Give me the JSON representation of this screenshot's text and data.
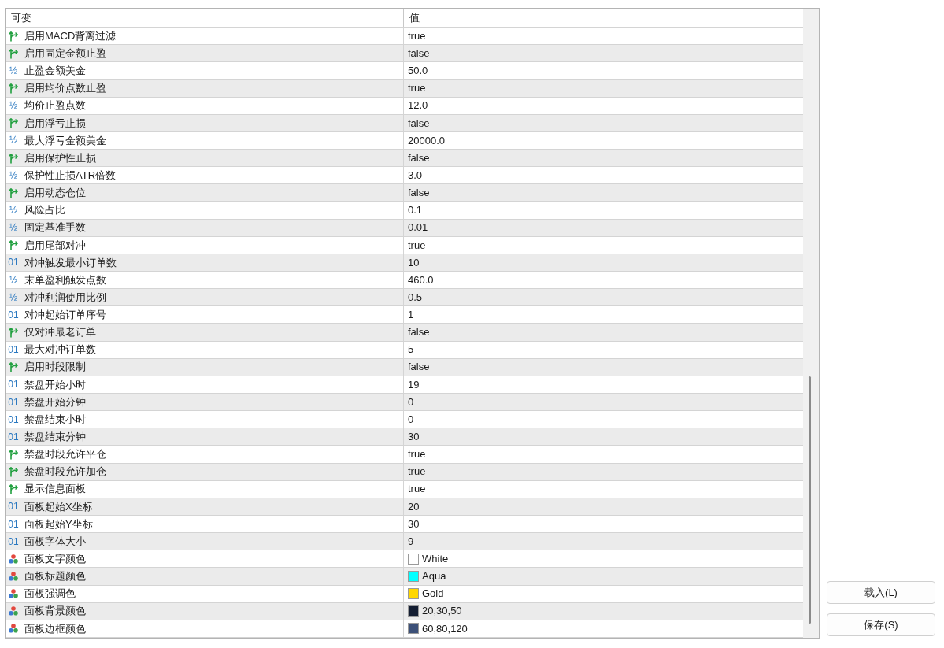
{
  "table": {
    "columns": [
      "可变",
      "值"
    ],
    "rows": [
      {
        "kind": "bool",
        "name": "启用MACD背离过滤",
        "value": "true"
      },
      {
        "kind": "bool",
        "name": "启用固定金额止盈",
        "value": "false"
      },
      {
        "kind": "double",
        "type_label": "½",
        "name": "止盈金额美金",
        "value": "50.0"
      },
      {
        "kind": "bool",
        "name": "启用均价点数止盈",
        "value": "true"
      },
      {
        "kind": "double",
        "type_label": "½",
        "name": "均价止盈点数",
        "value": "12.0"
      },
      {
        "kind": "bool",
        "name": "启用浮亏止损",
        "value": "false"
      },
      {
        "kind": "double",
        "type_label": "½",
        "name": "最大浮亏金额美金",
        "value": "20000.0"
      },
      {
        "kind": "bool",
        "name": "启用保护性止损",
        "value": "false"
      },
      {
        "kind": "double",
        "type_label": "½",
        "name": "保护性止损ATR倍数",
        "value": "3.0"
      },
      {
        "kind": "bool",
        "name": "启用动态仓位",
        "value": "false"
      },
      {
        "kind": "double",
        "type_label": "½",
        "name": "风险占比",
        "value": "0.1"
      },
      {
        "kind": "double",
        "type_label": "½",
        "name": "固定基准手数",
        "value": "0.01"
      },
      {
        "kind": "bool",
        "name": "启用尾部对冲",
        "value": "true"
      },
      {
        "kind": "int",
        "type_label": "01",
        "name": "对冲触发最小订单数",
        "value": "10"
      },
      {
        "kind": "double",
        "type_label": "½",
        "name": "末单盈利触发点数",
        "value": "460.0"
      },
      {
        "kind": "double",
        "type_label": "½",
        "name": "对冲利润使用比例",
        "value": "0.5"
      },
      {
        "kind": "int",
        "type_label": "01",
        "name": "对冲起始订单序号",
        "value": "1"
      },
      {
        "kind": "bool",
        "name": "仅对冲最老订单",
        "value": "false"
      },
      {
        "kind": "int",
        "type_label": "01",
        "name": "最大对冲订单数",
        "value": "5"
      },
      {
        "kind": "bool",
        "name": "启用时段限制",
        "value": "false"
      },
      {
        "kind": "int",
        "type_label": "01",
        "name": "禁盘开始小时",
        "value": "19"
      },
      {
        "kind": "int",
        "type_label": "01",
        "name": "禁盘开始分钟",
        "value": "0"
      },
      {
        "kind": "int",
        "type_label": "01",
        "name": "禁盘结束小时",
        "value": "0"
      },
      {
        "kind": "int",
        "type_label": "01",
        "name": "禁盘结束分钟",
        "value": "30"
      },
      {
        "kind": "bool",
        "name": "禁盘时段允许平仓",
        "value": "true"
      },
      {
        "kind": "bool",
        "name": "禁盘时段允许加仓",
        "value": "true"
      },
      {
        "kind": "bool",
        "name": "显示信息面板",
        "value": "true"
      },
      {
        "kind": "int",
        "type_label": "01",
        "name": "面板起始X坐标",
        "value": "20"
      },
      {
        "kind": "int",
        "type_label": "01",
        "name": "面板起始Y坐标",
        "value": "30"
      },
      {
        "kind": "int",
        "type_label": "01",
        "name": "面板字体大小",
        "value": "9"
      },
      {
        "kind": "color",
        "name": "面板文字颜色",
        "value": "White",
        "color": "#ffffff"
      },
      {
        "kind": "color",
        "name": "面板标题颜色",
        "value": "Aqua",
        "color": "#00ffff"
      },
      {
        "kind": "color",
        "name": "面板强调色",
        "value": "Gold",
        "color": "#ffd700"
      },
      {
        "kind": "color",
        "name": "面板背景颜色",
        "value": "20,30,50",
        "color": "#141e32"
      },
      {
        "kind": "color",
        "name": "面板边框颜色",
        "value": "60,80,120",
        "color": "#3c5078"
      }
    ]
  },
  "buttons": [
    "载入(L)",
    "保存(S)"
  ]
}
